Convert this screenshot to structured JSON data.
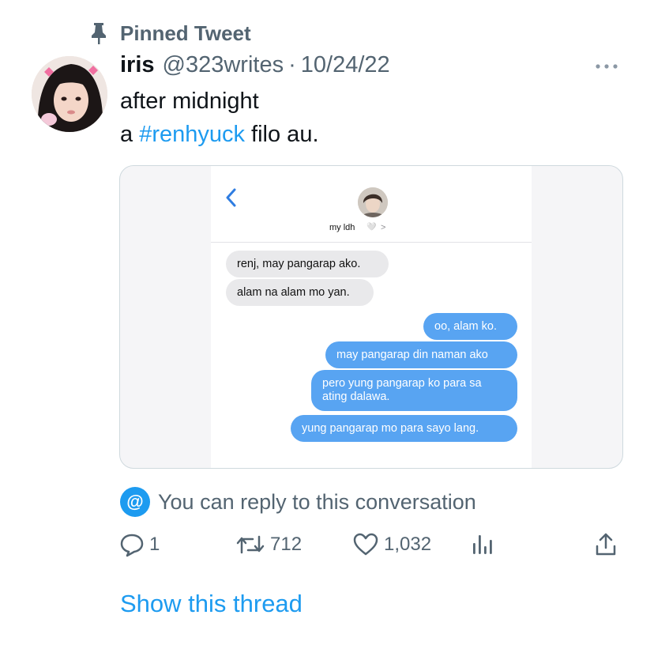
{
  "pinned": {
    "label": "Pinned Tweet",
    "icon": "pin-icon"
  },
  "tweet": {
    "author_name": "iris",
    "author_handle": "@323writes",
    "separator": "·",
    "date": "10/24/22",
    "line1": "after midnight",
    "line2_prefix": "a ",
    "hashtag": "#renhyuck",
    "line2_suffix": " filo au.",
    "more_icon": "more-dots-icon"
  },
  "screenshot": {
    "contact_name": "my ldh",
    "contact_heart": "🤍",
    "contact_chevron": ">",
    "messages": [
      {
        "side": "received",
        "text": "renj, may pangarap ako."
      },
      {
        "side": "received",
        "text": "alam na alam mo yan."
      },
      {
        "side": "sent",
        "text": "oo, alam ko."
      },
      {
        "side": "sent",
        "text": "may pangarap din naman ako"
      },
      {
        "side": "sent",
        "text": "pero yung pangarap ko para sa ating dalawa."
      },
      {
        "side": "sent",
        "text": "yung pangarap mo para sayo lang."
      }
    ]
  },
  "conversation": {
    "icon_glyph": "@",
    "text": "You can reply to this conversation"
  },
  "actions": {
    "reply_count": "1",
    "retweet_count": "712",
    "like_count": "1,032"
  },
  "show_thread": "Show this thread",
  "colors": {
    "accent": "#1d9bf0",
    "secondary_text": "#536471",
    "sent_bubble": "#58a4f2",
    "received_bubble": "#e9e9eb"
  }
}
